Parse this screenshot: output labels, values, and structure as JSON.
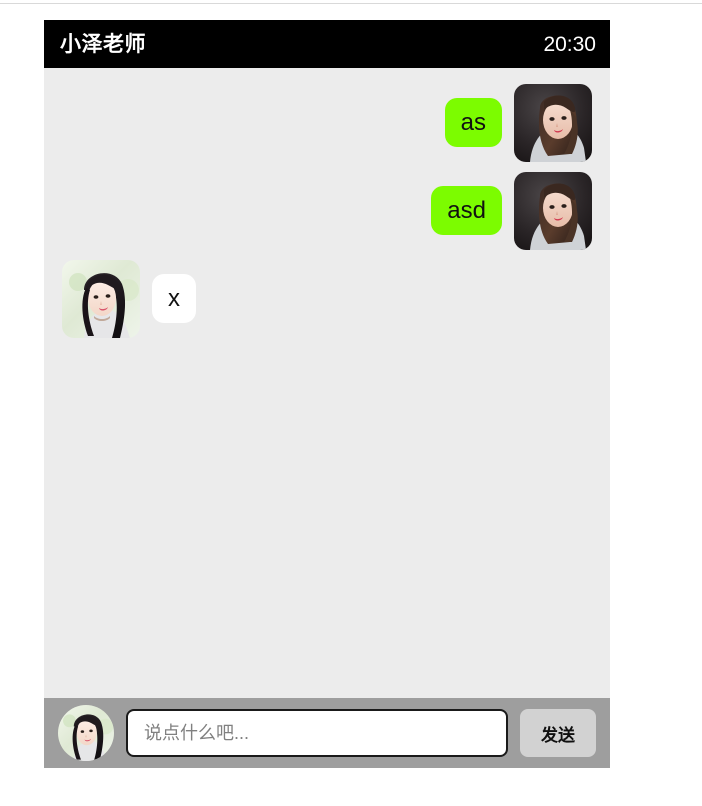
{
  "header": {
    "title": "小泽老师",
    "time": "20:30",
    "background": "#000000",
    "text_color": "#ffffff"
  },
  "theme": {
    "outgoing_bubble_color": "#7cfc00",
    "incoming_bubble_color": "#ffffff",
    "chat_background": "#ececec",
    "composer_background": "#9e9e9e",
    "send_button_color": "#d2d2d2"
  },
  "messages": [
    {
      "id": "msg-1",
      "direction": "outgoing",
      "text": "as",
      "avatar": "portrait-dark-background"
    },
    {
      "id": "msg-2",
      "direction": "outgoing",
      "text": "asd",
      "avatar": "portrait-dark-background"
    },
    {
      "id": "msg-3",
      "direction": "incoming",
      "text": "x",
      "avatar": "portrait-light-background"
    }
  ],
  "composer": {
    "avatar": "portrait-light-background",
    "input_value": "",
    "input_placeholder": "说点什么吧...",
    "send_label": "发送"
  }
}
